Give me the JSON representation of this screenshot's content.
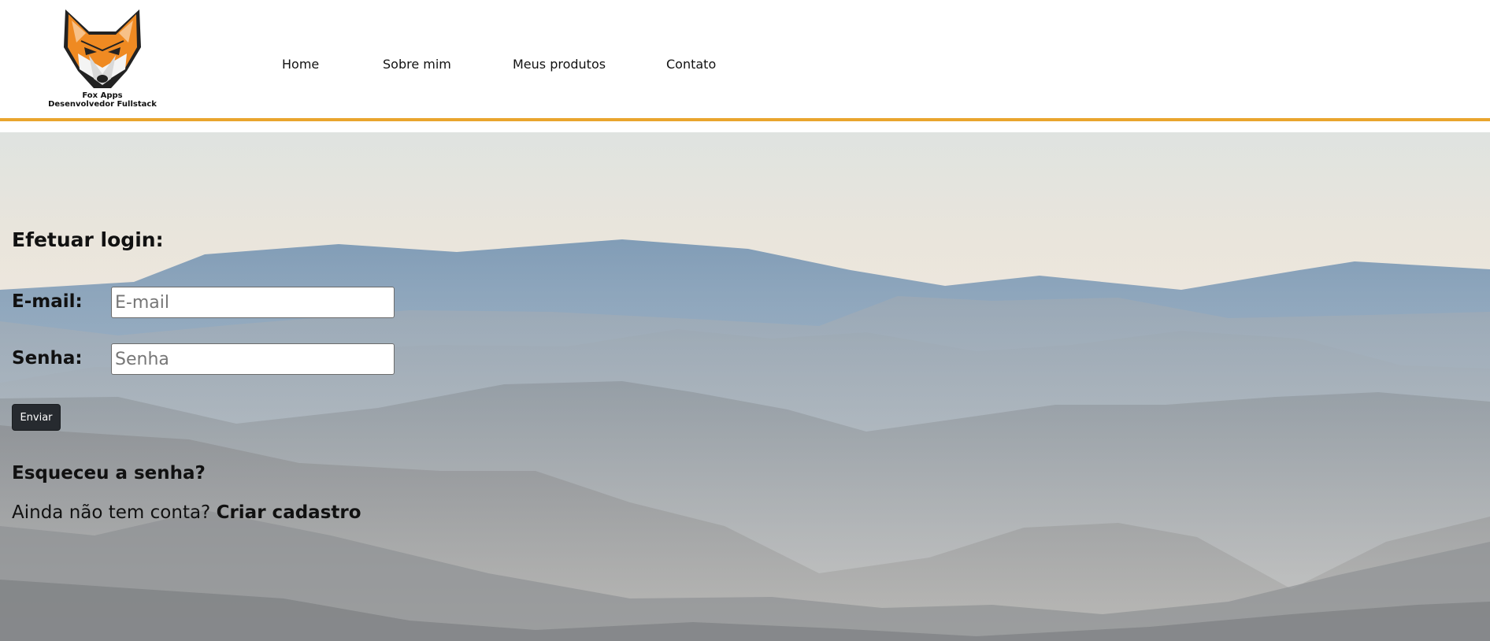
{
  "header": {
    "logo_name": "Fox Apps",
    "logo_tagline": "Desenvolvedor Fullstack",
    "accent_color": "#e9a52d"
  },
  "nav": {
    "items": [
      {
        "label": "Home"
      },
      {
        "label": "Sobre mim"
      },
      {
        "label": "Meus produtos"
      },
      {
        "label": "Contato"
      }
    ]
  },
  "login": {
    "title": "Efetuar login:",
    "email_label": "E-mail:",
    "email_placeholder": "E-mail",
    "email_value": "",
    "password_label": "Senha:",
    "password_placeholder": "Senha",
    "password_value": "",
    "submit_label": "Enviar",
    "forgot_label": "Esqueceu a senha?",
    "signup_prompt": "Ainda não tem conta?",
    "signup_link": "Criar cadastro"
  },
  "icons": {
    "logo": "fox-head-icon"
  }
}
